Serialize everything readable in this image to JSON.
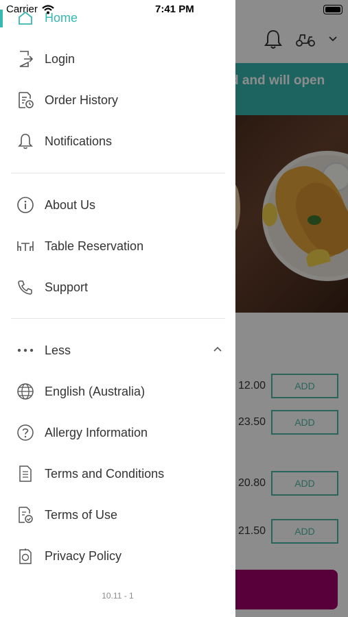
{
  "status_bar": {
    "carrier": "Carrier",
    "time": "7:41 PM"
  },
  "background": {
    "banner_text": "d and will open",
    "items": [
      {
        "price": "12.00",
        "button": "ADD"
      },
      {
        "price": "23.50",
        "button": "ADD"
      },
      {
        "price": "20.80",
        "button": "ADD"
      },
      {
        "price": "21.50",
        "button": "ADD"
      }
    ],
    "accent_color": "#36b7b0",
    "cart_color": "#a0006a"
  },
  "drawer": {
    "home": {
      "label": "Home",
      "icon": "home-icon"
    },
    "section1": [
      {
        "label": "Login",
        "icon": "login-icon"
      },
      {
        "label": "Order History",
        "icon": "order-history-icon"
      },
      {
        "label": "Notifications",
        "icon": "bell-icon"
      }
    ],
    "section2": [
      {
        "label": "About Us",
        "icon": "info-icon"
      },
      {
        "label": "Table Reservation",
        "icon": "table-icon"
      },
      {
        "label": "Support",
        "icon": "phone-icon"
      }
    ],
    "less": {
      "label": "Less",
      "icon": "more-dots-icon"
    },
    "section3": [
      {
        "label": "English (Australia)",
        "icon": "globe-icon"
      },
      {
        "label": "Allergy Information",
        "icon": "question-icon"
      },
      {
        "label": "Terms and Conditions",
        "icon": "document-icon"
      },
      {
        "label": "Terms of Use",
        "icon": "document-check-icon"
      },
      {
        "label": "Privacy Policy",
        "icon": "privacy-icon"
      }
    ],
    "version": "10.11 - 1"
  }
}
